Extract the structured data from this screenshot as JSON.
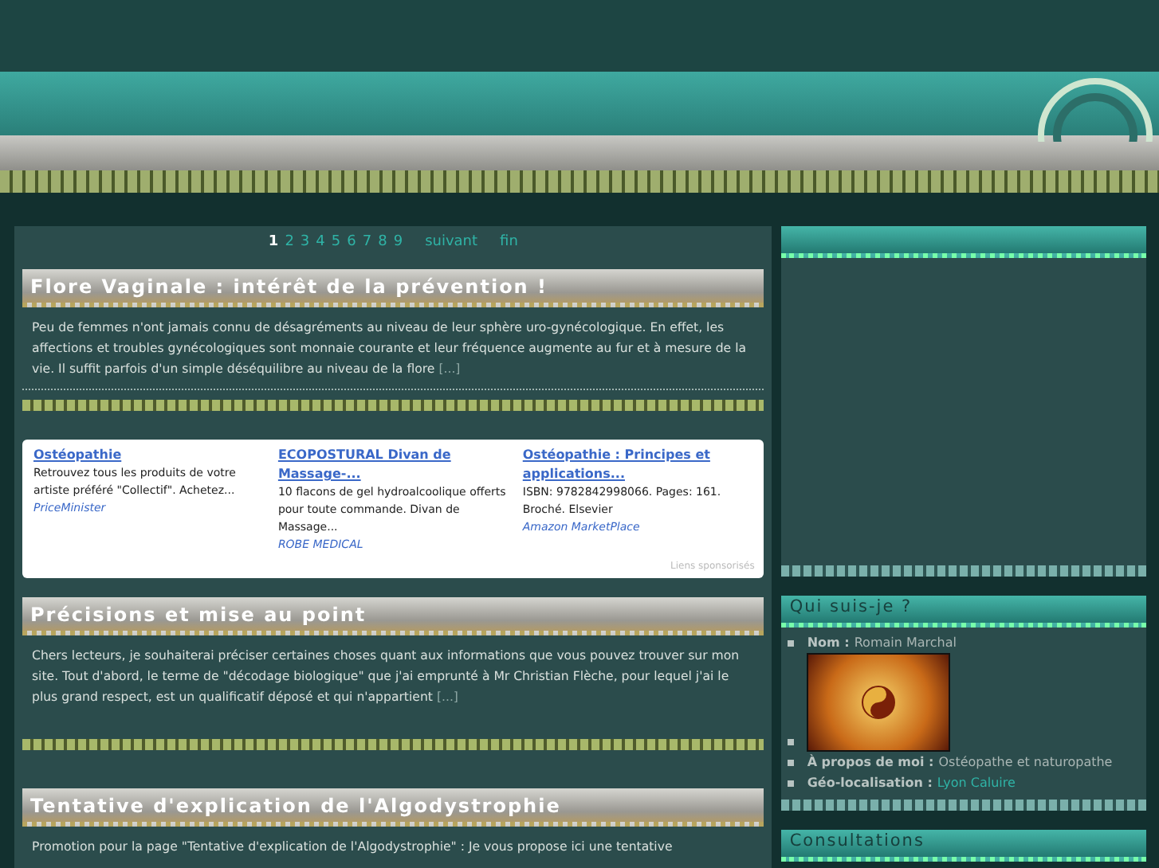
{
  "pagination": {
    "pages": [
      {
        "label": "1",
        "selected": true
      },
      {
        "label": "2",
        "selected": false
      },
      {
        "label": "3",
        "selected": false
      },
      {
        "label": "4",
        "selected": false
      },
      {
        "label": "5",
        "selected": false
      },
      {
        "label": "6",
        "selected": false
      },
      {
        "label": "7",
        "selected": false
      },
      {
        "label": "8",
        "selected": false
      },
      {
        "label": "9",
        "selected": false
      }
    ],
    "next": "suivant",
    "last": "fin"
  },
  "content": [
    {
      "kind": "post",
      "title": "Flore Vaginale : intérêt de la prévention !",
      "excerpt": "Peu de femmes n'ont jamais connu de désagréments au niveau de leur sphère uro-gynécologique. En effet, les affections et troubles gynécologiques sont monnaie courante et leur fréquence augmente au fur et à mesure de la vie. Il suffit parfois d'un simple déséquilibre au niveau de la flore",
      "more": "[...]"
    },
    {
      "kind": "ads",
      "items": [
        {
          "title": "Ostéopathie",
          "text": "Retrouvez tous les produits de votre artiste préféré \"Collectif\". Achetez...",
          "source": "PriceMinister"
        },
        {
          "title": "ECOPOSTURAL Divan de Massage-...",
          "text": "10 flacons de gel hydroalcoolique offerts pour toute commande. Divan de Massage...",
          "source": "ROBE MEDICAL"
        },
        {
          "title": "Ostéopathie : Principes et applications...",
          "text": "ISBN: 9782842998066. Pages: 161. Broché. Elsevier",
          "source": "Amazon MarketPlace"
        }
      ],
      "footer": "Liens sponsorisés"
    },
    {
      "kind": "post",
      "title": "Précisions et mise au point",
      "excerpt": "Chers lecteurs, je souhaiterai préciser certaines choses quant aux informations que vous pouvez trouver sur mon site. Tout d'abord, le terme de \"décodage biologique\" que j'ai emprunté à Mr Christian Flèche, pour lequel j'ai le plus grand respect, est un qualificatif déposé et qui n'appartient",
      "more": "[...]"
    },
    {
      "kind": "post",
      "title": "Tentative d'explication de l'Algodystrophie",
      "excerpt": "Promotion pour la page \"Tentative d'explication de l'Algodystrophie\" : Je vous propose ici une tentative"
    }
  ],
  "sidebar": {
    "widgets": [
      {
        "kind": "empty"
      },
      {
        "kind": "about",
        "title": "Qui suis-je ?",
        "items": [
          {
            "kind": "field",
            "label": "Nom :",
            "value": "Romain Marchal",
            "link": false
          },
          {
            "kind": "image"
          },
          {
            "kind": "field",
            "label": "À propos de moi :",
            "value": "Ostéopathe et naturopathe",
            "link": false
          },
          {
            "kind": "field",
            "label": "Géo-localisation :",
            "value": "Lyon Caluire",
            "link": true
          }
        ]
      },
      {
        "kind": "cut",
        "title": "Consultations"
      }
    ]
  }
}
